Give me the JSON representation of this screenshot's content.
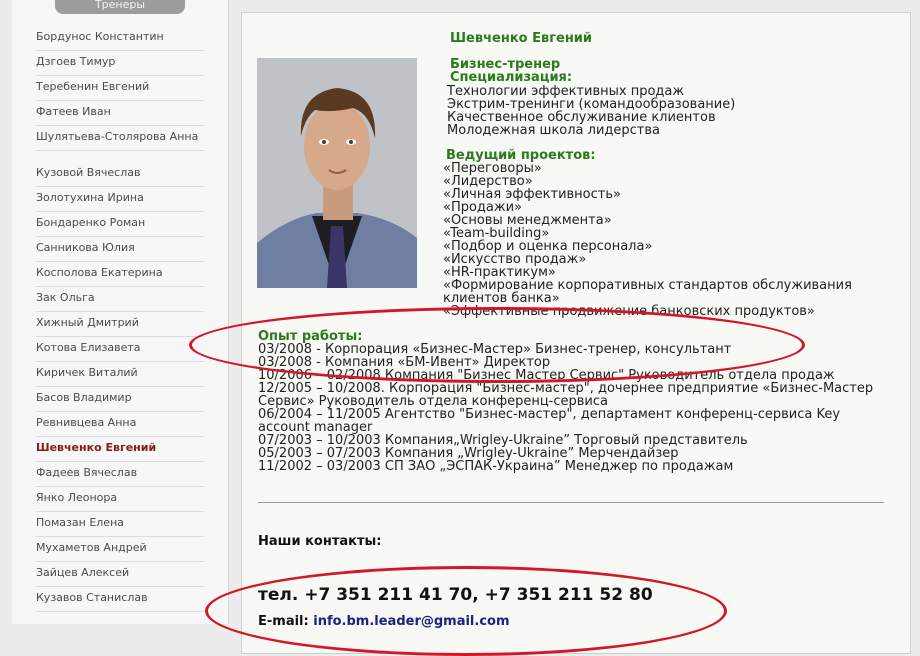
{
  "sidebar": {
    "header": "Тренеры",
    "items": [
      {
        "label": "Бордунос Константин"
      },
      {
        "label": "Дзгоев Тимур"
      },
      {
        "label": "Теребенин Евгений"
      },
      {
        "label": "Фатеев Иван"
      },
      {
        "label": "Шулятьева-Столярова Анна"
      },
      {
        "label": "Кузовой Вячеслав"
      },
      {
        "label": "Золотухина Ирина"
      },
      {
        "label": "Бондаренко Роман"
      },
      {
        "label": "Санникова Юлия"
      },
      {
        "label": "Косполова Екатерина"
      },
      {
        "label": "Зак Ольга"
      },
      {
        "label": "Хижный Дмитрий"
      },
      {
        "label": "Котова Елизавета"
      },
      {
        "label": "Киричек Виталий"
      },
      {
        "label": "Басов Владимир"
      },
      {
        "label": "Ревнивцева Анна"
      },
      {
        "label": "Шевченко Евгений",
        "active": true
      },
      {
        "label": "Фадеев Вячеслав"
      },
      {
        "label": "Янко Леонора"
      },
      {
        "label": "Помазан Елена"
      },
      {
        "label": "Мухаметов Андрей"
      },
      {
        "label": "Зайцев Алексей"
      },
      {
        "label": "Кузавов Станислав"
      }
    ]
  },
  "profile": {
    "name": "Шевченко Евгений",
    "role": "Бизнес-тренер",
    "specialization_heading": "Специализация:",
    "specializations": [
      "Технологии эффективных продаж",
      "Экстрим-тренинги (командообразование)",
      "Качественное обслуживание клиентов",
      "Молодежная школа лидерства"
    ],
    "projects_heading": "Ведущий проектов:",
    "projects": [
      "«Переговоры»",
      "«Лидерство»",
      "«Личная эффективность»",
      "«Продажи»",
      "«Основы менеджмента»",
      "«Team-building»",
      "«Подбор и оценка персонала»",
      "«Искусство продаж»",
      "«HR-практикум»",
      "«Формирование корпоративных стандартов обслуживания",
      "клиентов банка»",
      "«Эффективные продвижение банковских продуктов»"
    ],
    "experience_heading": "Опыт работы:",
    "experience": [
      "03/2008 - Корпорация «Бизнес-Мастер» Бизнес-тренер, консультант",
      "03/2008 - Компания «БМ-Ивент» Директор",
      "10/2006 – 02/2008 Компания \"Бизнес Мастер Сервис\" Руководитель отдела продаж",
      "12/2005 – 10/2008. Корпорация \"Бизнес-мастер\", дочернее предприятие «Бизнес-Мастер",
      "Сервис» Руководитель отдела конференц-сервиса",
      "06/2004 – 11/2005 Агентство \"Бизнес-мастер\", департамент конференц-сервиса Key",
      "account manager",
      "07/2003 – 10/2003 Компания„Wrigley-Ukraine” Торговый представитель",
      "05/2003 – 07/2003 Компания „Wrigley-Ukraine” Мерчендайзер",
      "11/2002 – 03/2003 СП ЗАО „ЭСПАК-Украина” Менеджер по продажам"
    ]
  },
  "contacts": {
    "heading": "Наши контакты:",
    "phone": "тел. +7 351 211 41 70, +7 351 211 52 80",
    "email_label": "E-mail:",
    "email": "info.bm.leader@gmail.com"
  },
  "colors": {
    "heading_green": "#2c7a1f",
    "active_item": "#8b1a1a",
    "highlight_oval": "#d3172a",
    "email_link": "#1a237e"
  }
}
